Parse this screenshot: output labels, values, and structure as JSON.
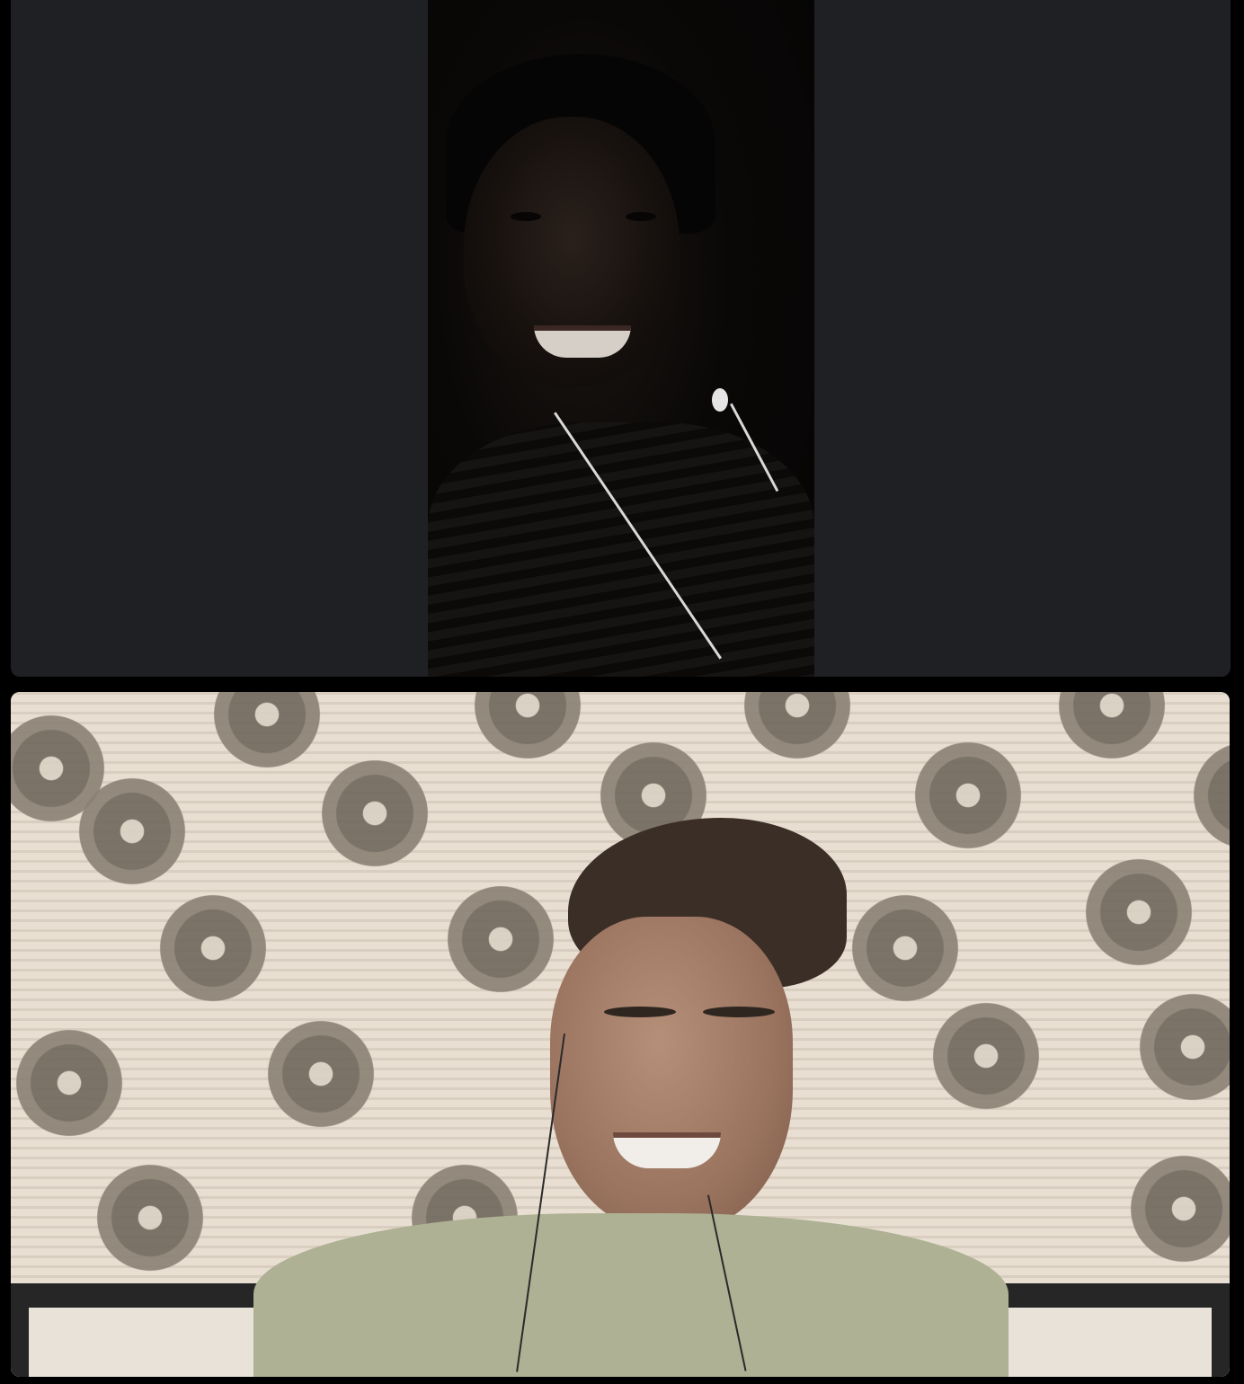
{
  "call": {
    "participants": [
      {
        "id": "remote-participant-top",
        "video": "on",
        "lighting": "dark"
      },
      {
        "id": "remote-participant-bottom",
        "video": "on",
        "lighting": "bright"
      }
    ]
  },
  "colors": {
    "page_background": "#000000",
    "tile_background": "#1f2024"
  }
}
